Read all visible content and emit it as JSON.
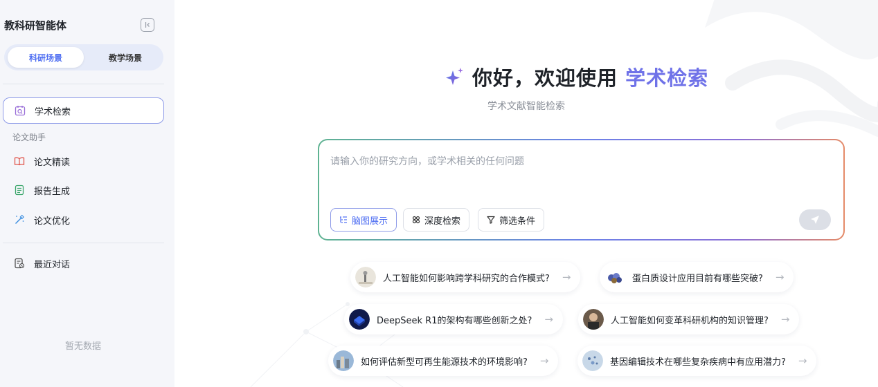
{
  "sidebar": {
    "app_title": "教科研智能体",
    "scene_tabs": [
      "科研场景",
      "教学场景"
    ],
    "active_item": "学术检索",
    "section_label": "论文助手",
    "assistant_items": [
      "论文精读",
      "报告生成",
      "论文优化"
    ],
    "recent_label": "最近对话",
    "empty_text": "暂无数据"
  },
  "main": {
    "greeting": "你好，欢迎使用",
    "greeting_accent": "学术检索",
    "subtitle": "学术文献智能检索",
    "search_placeholder": "请输入你的研究方向，或学术相关的任何问题",
    "chips": [
      "脑图展示",
      "深度检索",
      "筛选条件"
    ],
    "suggestions": [
      "人工智能如何影响跨学科研究的合作模式?",
      "蛋白质设计应用目前有哪些突破?",
      "DeepSeek R1的架构有哪些创新之处?",
      "人工智能如何变革科研机构的知识管理?",
      "如何评估新型可再生能源技术的环境影响?",
      "基因编辑技术在哪些复杂疾病中有应用潜力?"
    ]
  },
  "colors": {
    "accent": "#6f72e8",
    "primary_blue": "#4e6ef2",
    "sidebar_bg": "#f5f6fa"
  },
  "icons": {
    "collapse": "collapse-sidebar-icon",
    "search_nav": "academic-search-icon",
    "read": "open-book-icon",
    "report": "report-list-icon",
    "optimize": "magic-wand-icon",
    "recent": "chat-history-icon",
    "sparkle": "sparkle-icon",
    "send": "send-icon",
    "arrow": "arrow-right-icon"
  }
}
